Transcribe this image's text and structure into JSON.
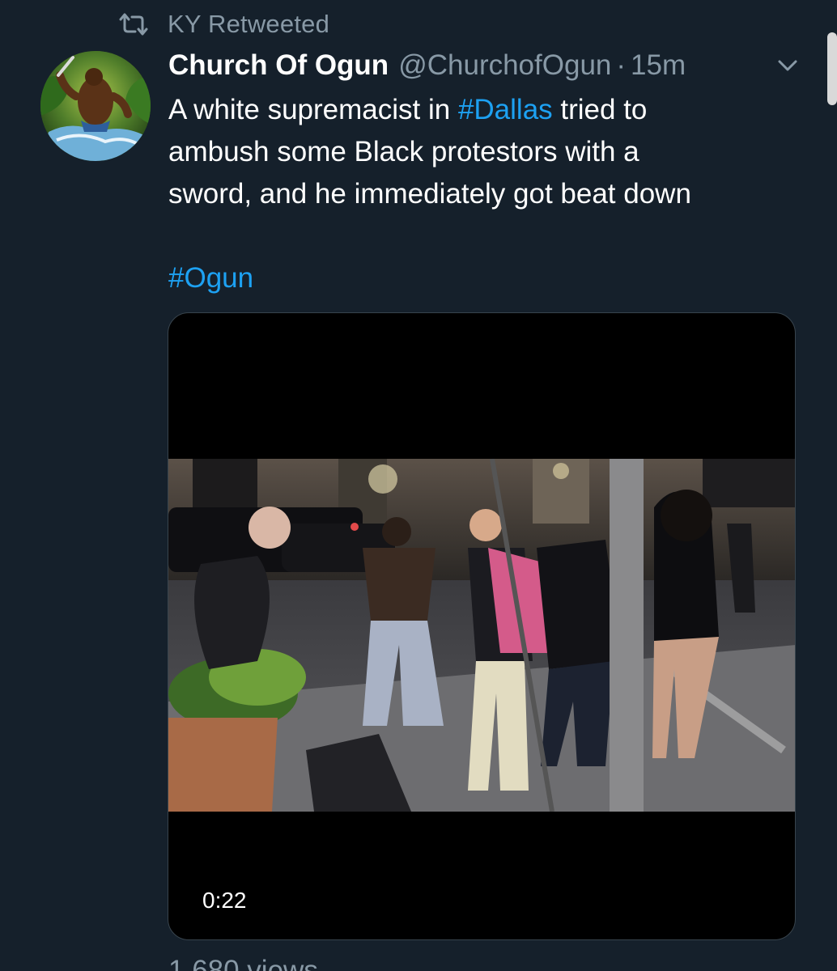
{
  "retweet_context": {
    "label": "KY Retweeted",
    "icon": "retweet-icon"
  },
  "author": {
    "display_name": "Church Of Ogun",
    "handle": "@ChurchofOgun",
    "separator": "·",
    "time_ago": "15m"
  },
  "tweet": {
    "line1_before": "A white supremacist in ",
    "line1_hashtag": "#Dallas",
    "line1_after": " tried to",
    "line2": "ambush some Black protestors with a",
    "line3": "sword, and he immediately got beat down",
    "hashtag_line": "#Ogun"
  },
  "media": {
    "duration": "0:22"
  },
  "views": "1,680 views",
  "colors": {
    "background": "#15202b",
    "text_primary": "#ffffff",
    "text_secondary": "#8899a6",
    "link": "#1da1f2"
  }
}
